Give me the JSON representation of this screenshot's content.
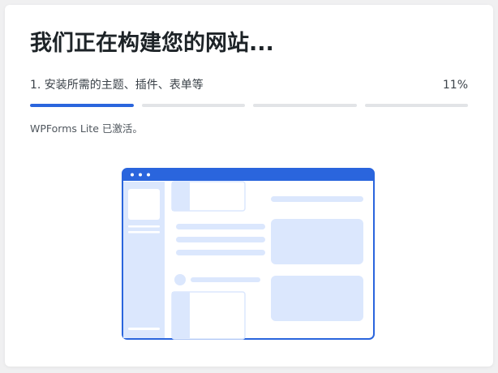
{
  "title": "我们正在构建您的网站...",
  "step": {
    "label": "1. 安装所需的主题、插件、表单等",
    "percent_text": "11%"
  },
  "progress": {
    "segments": 4,
    "active_segment": 1
  },
  "status_text": "WPForms Lite 已激活。",
  "colors": {
    "accent": "#2a65dd",
    "track": "#e2e4e7",
    "illustration_fill": "#dbe7fd"
  }
}
